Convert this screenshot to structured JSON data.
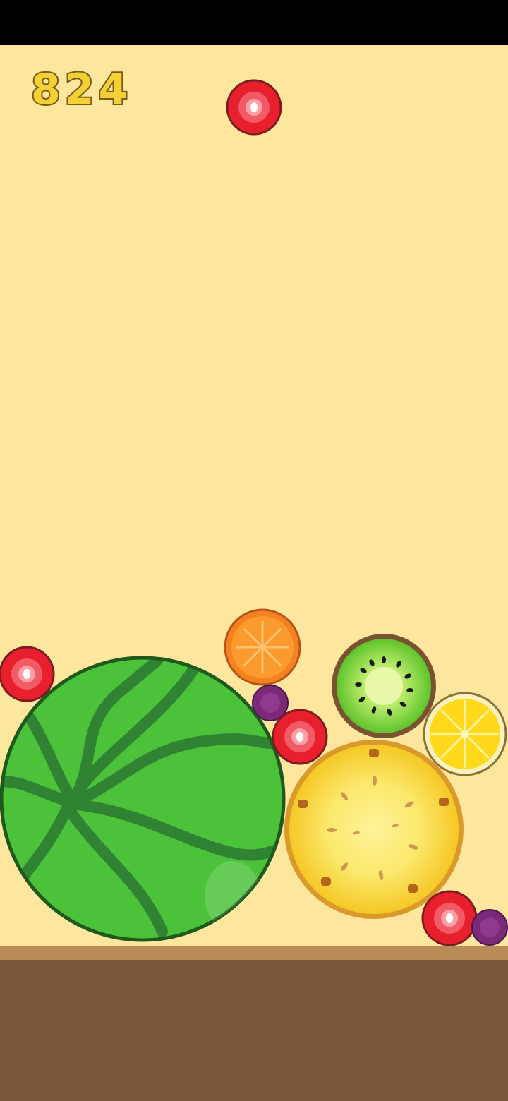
{
  "score": "824",
  "colors": {
    "background": "#fde69d",
    "score_fill": "#f3d033",
    "score_outline": "#7a5a1a",
    "ground_top": "#b88c57",
    "ground": "#7a5539"
  },
  "fruit_types": [
    "watermelon",
    "pineapple",
    "kiwi",
    "lemon",
    "orange",
    "strawberry",
    "grape"
  ],
  "next_fruit": "strawberry"
}
